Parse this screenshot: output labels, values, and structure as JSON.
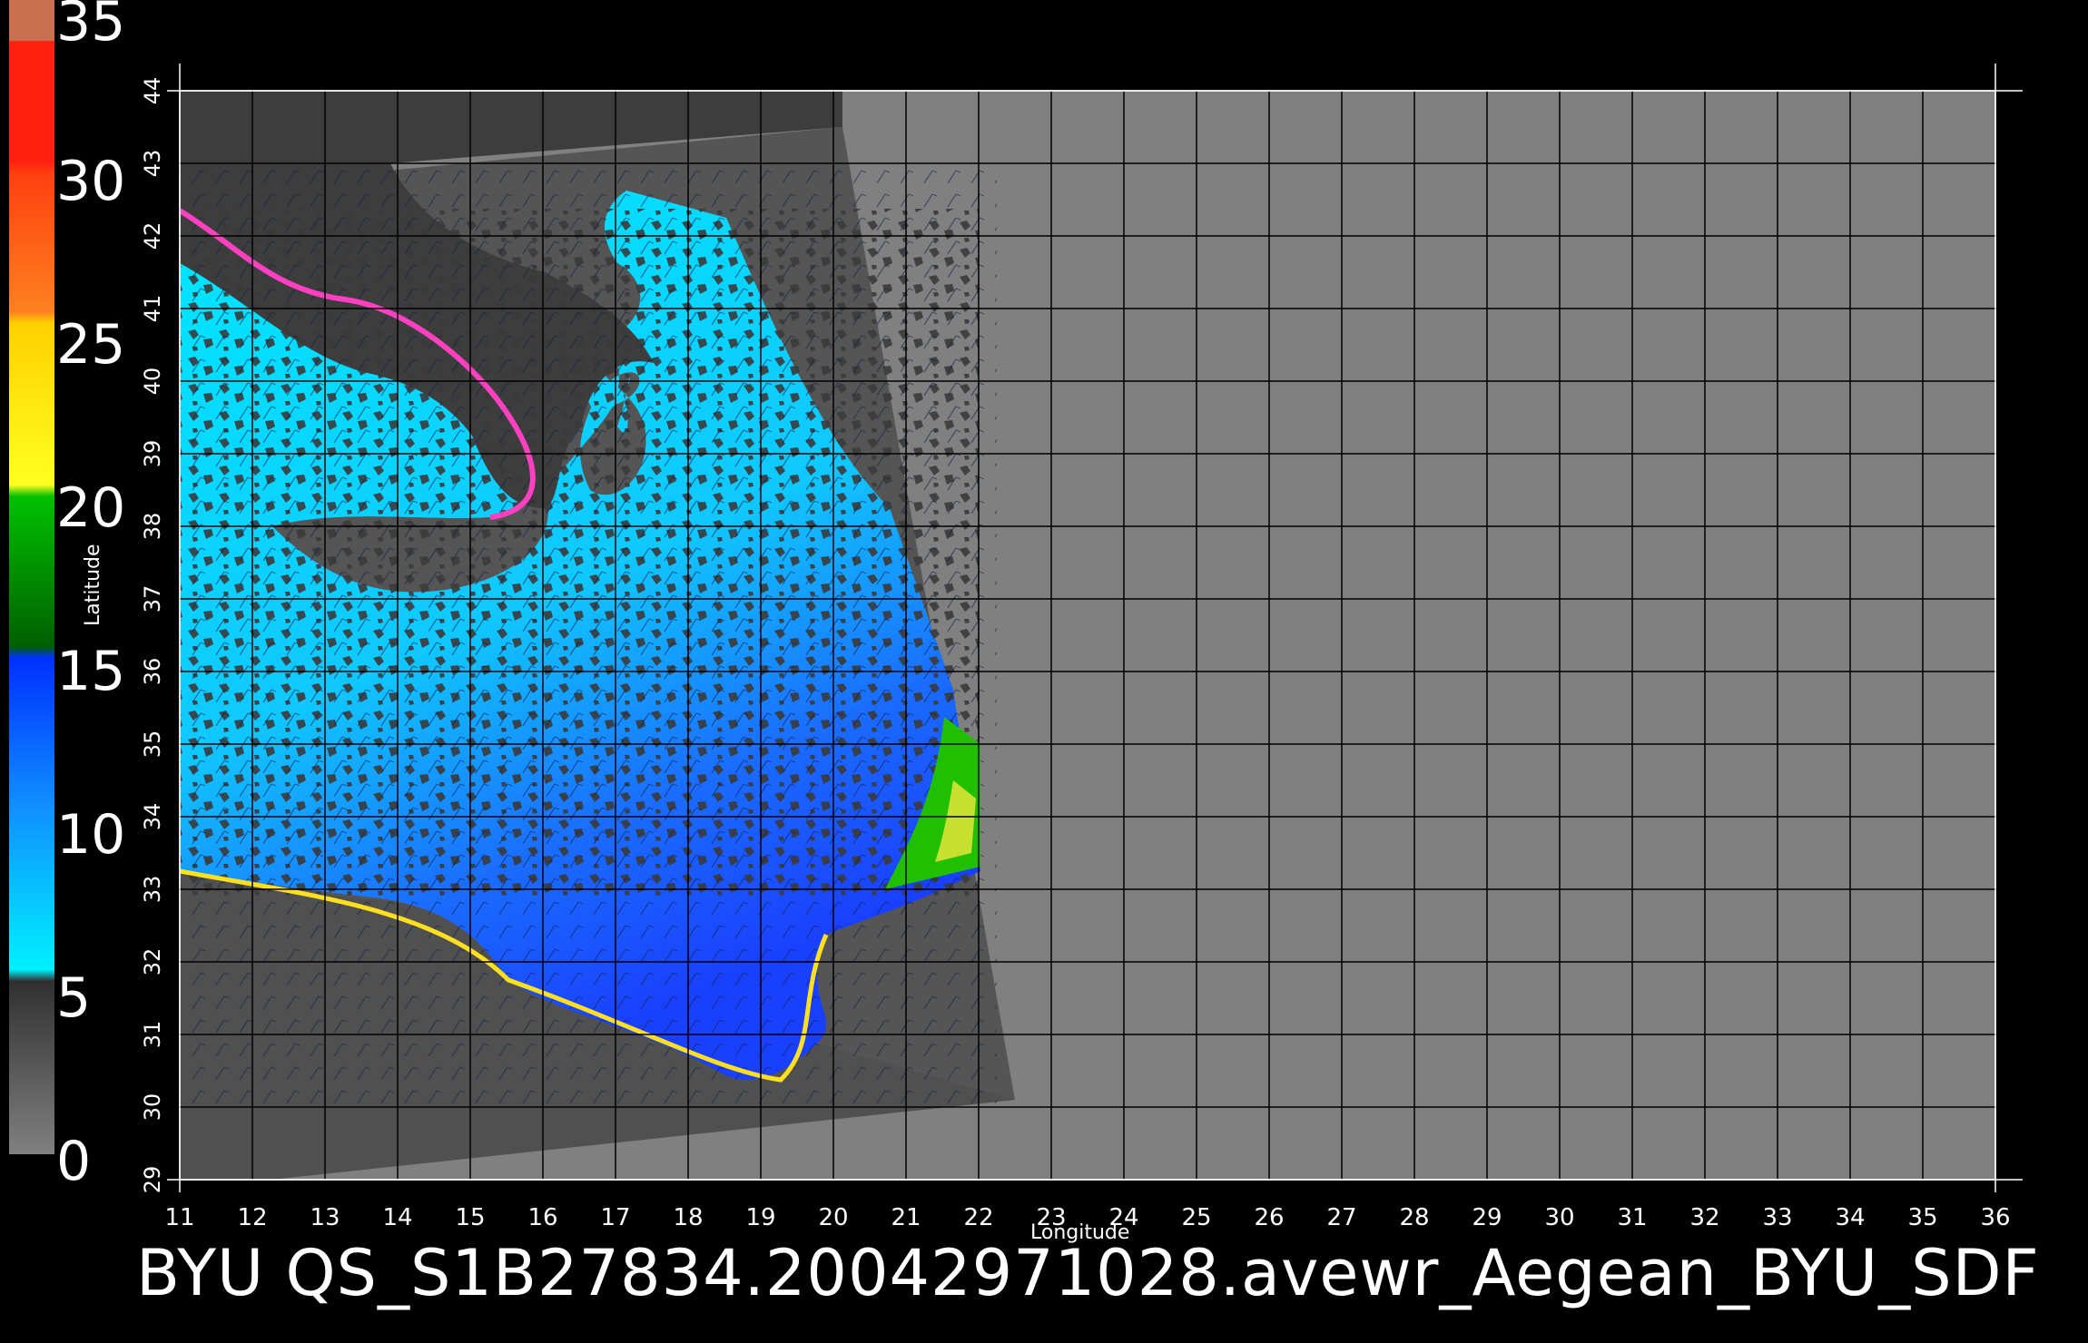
{
  "title": "BYU  QS_S1B27834.20042971028.avewr_Aegean_BYU_SDF",
  "colorbar": {
    "labels": [
      "35",
      "30",
      "25",
      "20",
      "15",
      "10",
      "5",
      "0"
    ],
    "stops": [
      "#c87050",
      "#ff2010",
      "#ff4010",
      "#ff8020",
      "#ffd000",
      "#ffff20",
      "#00c000",
      "#006000",
      "#0030ff",
      "#1090ff",
      "#00f0ff",
      "#303030",
      "#808080"
    ]
  },
  "axes": {
    "xlabel": "Longitude",
    "ylabel": "Latitude",
    "xticks": [
      "11",
      "12",
      "13",
      "14",
      "15",
      "16",
      "17",
      "18",
      "19",
      "20",
      "21",
      "22",
      "23",
      "24",
      "25",
      "26",
      "27",
      "28",
      "29",
      "30",
      "31",
      "32",
      "33",
      "34",
      "35",
      "36"
    ],
    "yticks": [
      "29",
      "30",
      "31",
      "32",
      "33",
      "34",
      "35",
      "36",
      "37",
      "38",
      "39",
      "40",
      "41",
      "42",
      "43",
      "44"
    ]
  },
  "colors": {
    "background": "#000000",
    "map_background": "#808080",
    "swath": "#555555",
    "land": "#3c3c3c",
    "grid": "#000000",
    "water_low": "#00e8ff",
    "water_high": "#1a5cff"
  }
}
